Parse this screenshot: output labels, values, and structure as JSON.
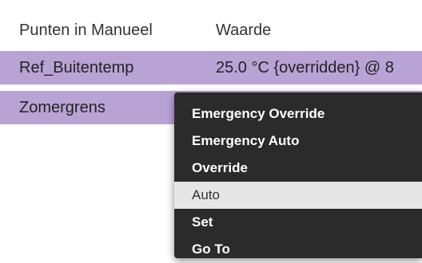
{
  "table": {
    "columns": [
      "Punten in Manueel",
      "Waarde"
    ],
    "rows": [
      {
        "name": "Ref_Buitentemp",
        "value": "25.0 °C {overridden} @ 8"
      },
      {
        "name": "Zomergrens",
        "value": ""
      }
    ]
  },
  "context_menu": {
    "items": [
      "Emergency Override",
      "Emergency Auto",
      "Override",
      "Auto",
      "Set",
      "Go To"
    ],
    "hovered_item": "Auto"
  },
  "colors": {
    "row_highlight": "#b9a3d5",
    "menu_background": "#2b2b2b",
    "menu_hover": "#e6e6e6"
  }
}
